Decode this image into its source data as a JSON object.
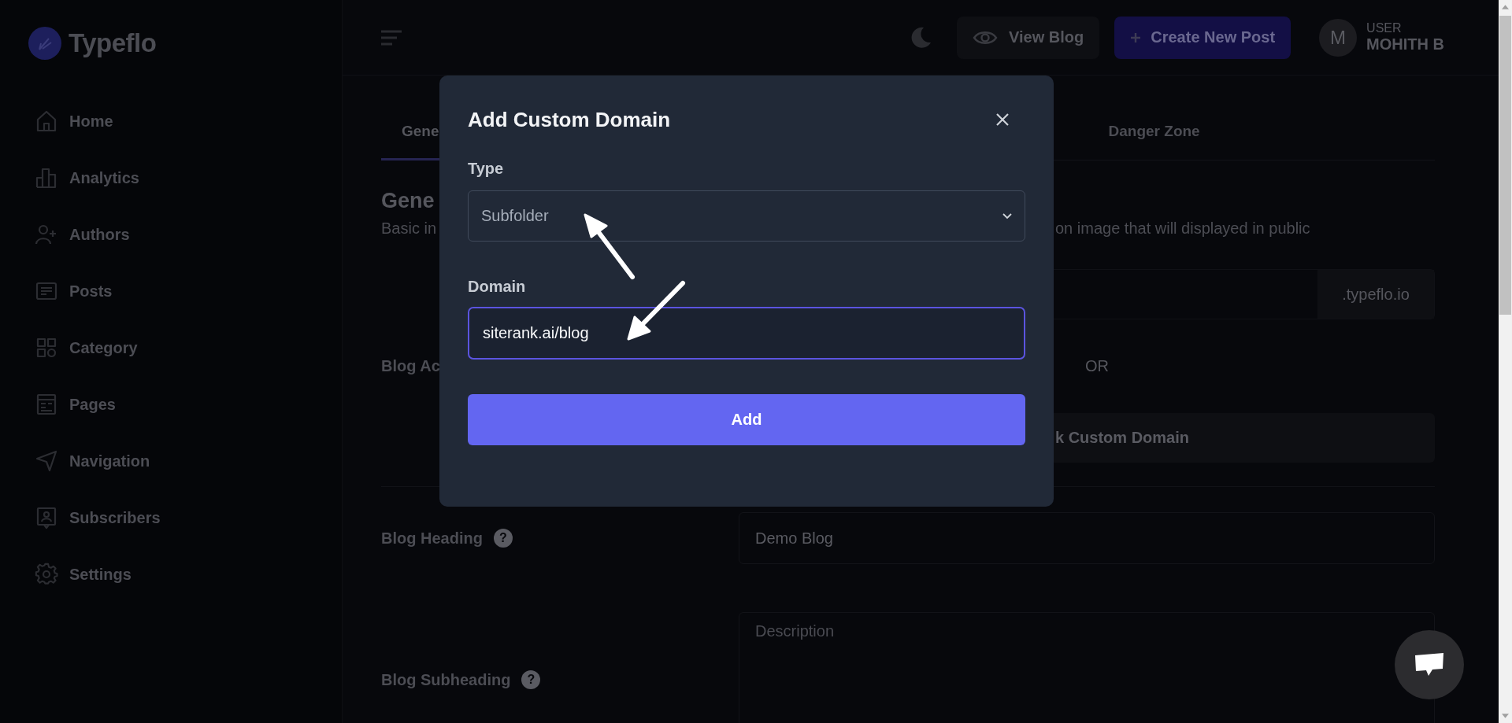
{
  "sidebar": {
    "brand": "Typeflo",
    "items": [
      {
        "label": "Home"
      },
      {
        "label": "Analytics"
      },
      {
        "label": "Authors"
      },
      {
        "label": "Posts"
      },
      {
        "label": "Category"
      },
      {
        "label": "Pages"
      },
      {
        "label": "Navigation"
      },
      {
        "label": "Subscribers"
      },
      {
        "label": "Settings"
      }
    ]
  },
  "topbar": {
    "view_blog": "View Blog",
    "create_post": "Create New Post",
    "avatar_letter": "M",
    "user_caption": "USER",
    "user_name": "MOHITH B"
  },
  "tabs": [
    {
      "label": "Gene",
      "selected": true
    },
    {
      "label": "Danger Zone",
      "selected": false
    }
  ],
  "section": {
    "title": "Gene",
    "description_start": "Basic in",
    "description_end": "on image that will displayed in public"
  },
  "form": {
    "subdomain_suffix": ".typeflo.io",
    "address_label": "Blog Ac",
    "or_text": "OR",
    "custom_domain_button": "k Custom Domain",
    "heading_label": "Blog Heading",
    "heading_help": "?",
    "heading_value": "Demo Blog",
    "subheading_label": "Blog Subheading",
    "subheading_help": "?",
    "subheading_placeholder": "Description"
  },
  "modal": {
    "title": "Add Custom Domain",
    "type_label": "Type",
    "type_value": "Subfolder",
    "domain_label": "Domain",
    "domain_value": "siterank.ai/blog",
    "domain_focused": true,
    "submit": "Add"
  }
}
